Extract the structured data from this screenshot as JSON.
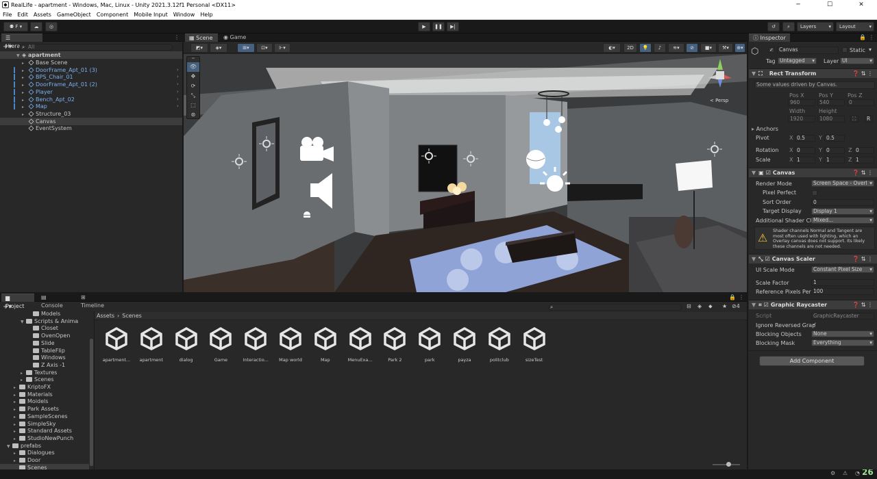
{
  "window": {
    "title": "RealLife - apartment - Windows, Mac, Linux - Unity 2021.3.12f1 Personal <DX11>",
    "min": "─",
    "max": "☐",
    "close": "✕"
  },
  "menu": [
    "File",
    "Edit",
    "Assets",
    "GameObject",
    "Component",
    "Mobile Input",
    "Window",
    "Help"
  ],
  "toolbar": {
    "account": "F",
    "layers": "Layers",
    "layout": "Layout"
  },
  "hierarchy": {
    "tab": "Hierarchy",
    "search_placeholder": "All",
    "scene": "apartment",
    "items": [
      {
        "name": "Base Scene",
        "blue": false
      },
      {
        "name": "DoorFrame_Apt_01 (3)",
        "blue": true
      },
      {
        "name": "BPS_Chair_01",
        "blue": true
      },
      {
        "name": "DoorFrame_Apt_01 (2)",
        "blue": true
      },
      {
        "name": "Player",
        "blue": true
      },
      {
        "name": "Bench_Apt_02",
        "blue": true
      },
      {
        "name": "Map",
        "blue": true
      },
      {
        "name": "Structure_03",
        "blue": false
      },
      {
        "name": "Canvas",
        "blue": false
      },
      {
        "name": "EventSystem",
        "blue": false
      }
    ]
  },
  "scene_view": {
    "tabs": [
      "Scene",
      "Game"
    ],
    "mode_2d": "2D",
    "persp": "< Persp"
  },
  "project": {
    "tabs": [
      "Project",
      "Console",
      "Timeline"
    ],
    "breadcrumb": [
      "Assets",
      "Scenes"
    ],
    "hidden_count": "4",
    "tree": [
      {
        "name": "Models",
        "indent": 3
      },
      {
        "name": "Scripts & Anima",
        "indent": 2
      },
      {
        "name": "Closet",
        "indent": 3
      },
      {
        "name": "OvenOpen",
        "indent": 3
      },
      {
        "name": "Slide",
        "indent": 3
      },
      {
        "name": "TableFlip",
        "indent": 3
      },
      {
        "name": "Windows",
        "indent": 3
      },
      {
        "name": "Z Axis -1",
        "indent": 3
      },
      {
        "name": "Textures",
        "indent": 2
      },
      {
        "name": "Scenes",
        "indent": 2
      },
      {
        "name": "KriptoFX",
        "indent": 1
      },
      {
        "name": "Materials",
        "indent": 1
      },
      {
        "name": "Moidels",
        "indent": 1
      },
      {
        "name": "Park Assets",
        "indent": 1
      },
      {
        "name": "SampleScenes",
        "indent": 1
      },
      {
        "name": "SimpleSky",
        "indent": 1
      },
      {
        "name": "Standard Assets",
        "indent": 1
      },
      {
        "name": "StudioNewPunch",
        "indent": 1
      },
      {
        "name": "prefabs",
        "indent": 0
      },
      {
        "name": "Dialogues",
        "indent": 1
      },
      {
        "name": "Door",
        "indent": 1
      },
      {
        "name": "Scenes",
        "indent": 1
      }
    ],
    "assets": [
      "apartment...",
      "apartment",
      "dialog",
      "Game",
      "Interactio...",
      "Map world",
      "Map",
      "MenuExa...",
      "Park 2",
      "park",
      "payza",
      "politclub",
      "sizeTest"
    ]
  },
  "inspector": {
    "tab": "Inspector",
    "object_name": "Canvas",
    "static": "Static",
    "tag_label": "Tag",
    "tag": "Untagged",
    "layer_label": "Layer",
    "layer": "UI",
    "rect": {
      "title": "Rect Transform",
      "note": "Some values driven by Canvas.",
      "posx_l": "Pos X",
      "posy_l": "Pos Y",
      "posz_l": "Pos Z",
      "posx": "960",
      "posy": "540",
      "posz": "0",
      "w_l": "Width",
      "h_l": "Height",
      "w": "1920",
      "h": "1080",
      "anchors": "Anchors",
      "pivot": "Pivot",
      "pivot_x": "0.5",
      "pivot_y": "0.5",
      "rotation": "Rotation",
      "rot_x": "0",
      "rot_y": "0",
      "rot_z": "0",
      "scale": "Scale",
      "sc_x": "1",
      "sc_y": "1",
      "sc_z": "1",
      "x": "X",
      "y": "Y",
      "z": "Z",
      "r": "R"
    },
    "canvas": {
      "title": "Canvas",
      "render_mode_l": "Render Mode",
      "render_mode": "Screen Space - Overl",
      "pixel_perfect_l": "Pixel Perfect",
      "sort_order_l": "Sort Order",
      "sort_order": "0",
      "target_display_l": "Target Display",
      "target_display": "Display 1",
      "shader_ch_l": "Additional Shader Ch",
      "shader_ch": "Mixed...",
      "warning": "Shader channels Normal and Tangent are most often used with lighting, which an Overlay canvas does not support. Its likely these channels are not needed."
    },
    "scaler": {
      "title": "Canvas Scaler",
      "mode_l": "UI Scale Mode",
      "mode": "Constant Pixel Size",
      "factor_l": "Scale Factor",
      "factor": "1",
      "ref_l": "Reference Pixels Per",
      "ref": "100"
    },
    "raycaster": {
      "title": "Graphic Raycaster",
      "script_l": "Script",
      "script": "GraphicRaycaster",
      "ignore_l": "Ignore Reversed Grap",
      "blocking_l": "Blocking Objects",
      "blocking": "None",
      "mask_l": "Blocking Mask",
      "mask": "Everything"
    },
    "add_component": "Add Component"
  },
  "status": {
    "fps": "26"
  }
}
